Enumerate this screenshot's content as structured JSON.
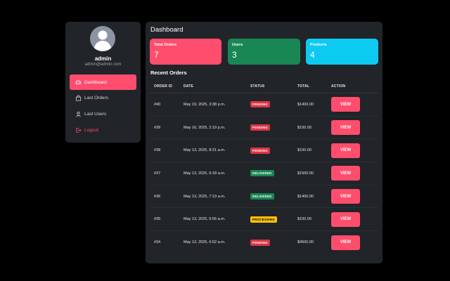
{
  "colors": {
    "background": "#000000",
    "panel": "#212429",
    "accent": "#ff4d6d",
    "success": "#198754",
    "info": "#0dcaf0",
    "danger": "#dc3545",
    "warning": "#ffc107"
  },
  "sidebar": {
    "user": {
      "name": "admin",
      "email": "admin@admin.com",
      "avatar_icon": "user-silhouette-icon"
    },
    "items": [
      {
        "label": "Dashboard",
        "icon": "speedometer-icon",
        "active": true
      },
      {
        "label": "Last Orders",
        "icon": "bag-icon",
        "active": false
      },
      {
        "label": "Last Users",
        "icon": "person-icon",
        "active": false
      },
      {
        "label": "Logout",
        "icon": "logout-icon",
        "active": false
      }
    ]
  },
  "main": {
    "title": "Dashboard",
    "stats": [
      {
        "label": "Total Orders",
        "value": "7"
      },
      {
        "label": "Users",
        "value": "3"
      },
      {
        "label": "Products",
        "value": "4"
      }
    ],
    "recent_orders": {
      "title": "Recent Orders",
      "columns": [
        "ORDER ID",
        "DATE",
        "STATUS",
        "TOTAL",
        "ACTION"
      ],
      "rows": [
        {
          "id": "#40",
          "date": "May 19, 2025, 3:38 p.m.",
          "status": "PENDING",
          "total": "$1400.00",
          "action": "VIEW"
        },
        {
          "id": "#39",
          "date": "May 16, 2025, 2:19 p.m.",
          "status": "PENDING",
          "total": "$100.00",
          "action": "VIEW"
        },
        {
          "id": "#38",
          "date": "May 13, 2025, 8:21 a.m.",
          "status": "PENDING",
          "total": "$100.00",
          "action": "VIEW"
        },
        {
          "id": "#37",
          "date": "May 13, 2025, 6:18 a.m.",
          "status": "DELIVERED",
          "total": "$1500.00",
          "action": "VIEW"
        },
        {
          "id": "#36",
          "date": "May 13, 2025, 7:13 a.m.",
          "status": "DELIVERED",
          "total": "$1400.00",
          "action": "VIEW"
        },
        {
          "id": "#35",
          "date": "May 13, 2025, 6:55 a.m.",
          "status": "PROCESSING",
          "total": "$100.00",
          "action": "VIEW"
        },
        {
          "id": "#34",
          "date": "May 13, 2025, 6:52 a.m.",
          "status": "PENDING",
          "total": "$4500.00",
          "action": "VIEW"
        }
      ]
    }
  }
}
